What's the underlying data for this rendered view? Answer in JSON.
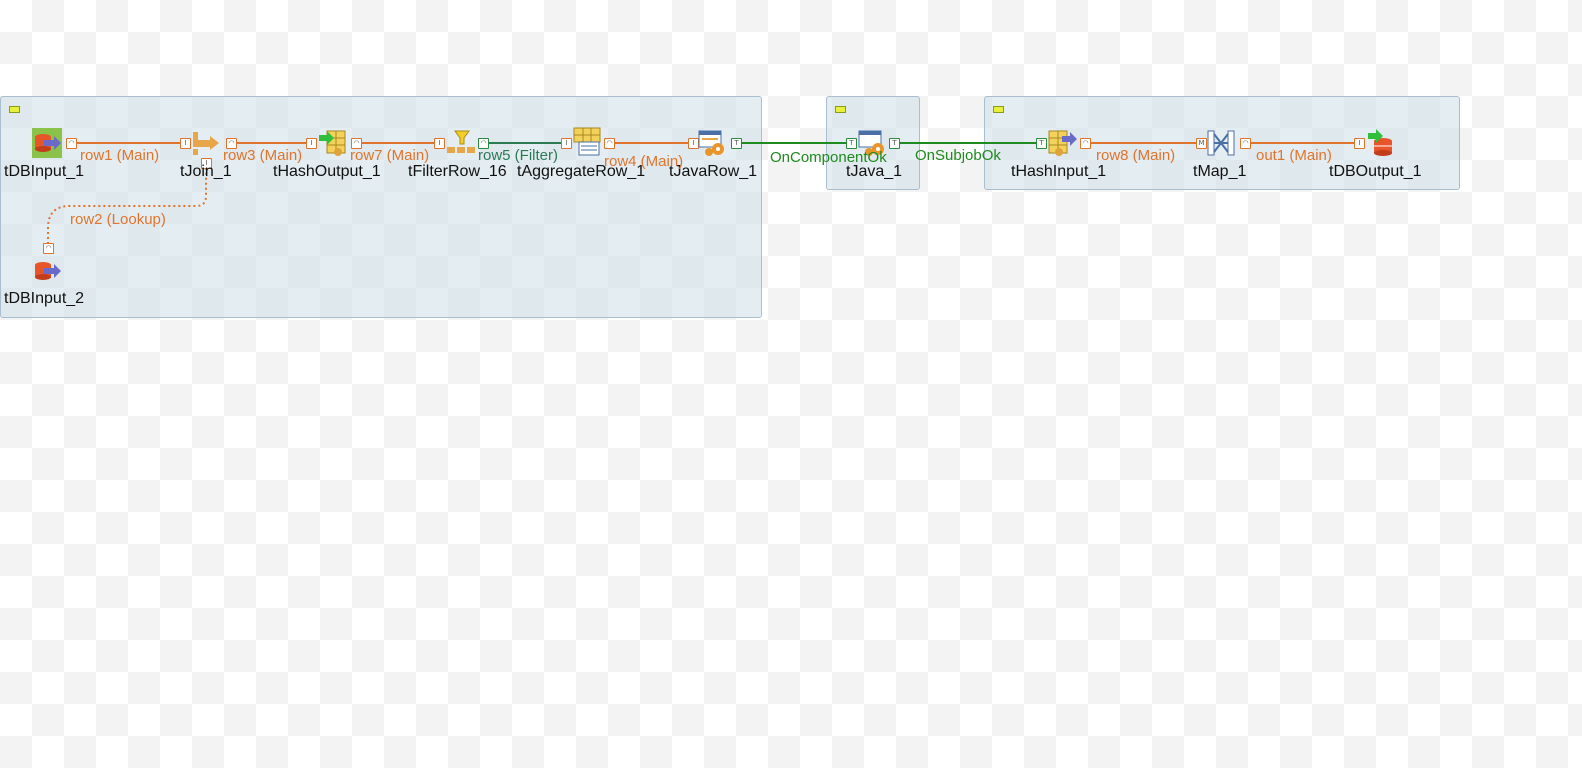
{
  "components": {
    "tDBInput_1": "tDBInput_1",
    "tJoin_1": "tJoin_1",
    "tHashOutput_1": "tHashOutput_1",
    "tFilterRow_16": "tFilterRow_16",
    "tAggregateRow_1": "tAggregateRow_1",
    "tJavaRow_1": "tJavaRow_1",
    "tDBInput_2": "tDBInput_2",
    "tJava_1": "tJava_1",
    "tHashInput_1": "tHashInput_1",
    "tMap_1": "tMap_1",
    "tDBOutput_1": "tDBOutput_1"
  },
  "links": {
    "row1": "row1 (Main)",
    "row3": "row3 (Main)",
    "row7": "row7 (Main)",
    "row5": "row5 (Filter)",
    "row4": "row4 (Main)",
    "row2": "row2 (Lookup)",
    "oncomponentok": "OnComponentOk",
    "onsubjobok": "OnSubjobOk",
    "row8": "row8 (Main)",
    "out1": "out1 (Main)"
  },
  "colors": {
    "main_link": "#e0742c",
    "filter_link": "#2b7a54",
    "trigger_link": "#1f8a1f",
    "subjob_bg": "#cddee8",
    "selected": "#8bc34a"
  }
}
